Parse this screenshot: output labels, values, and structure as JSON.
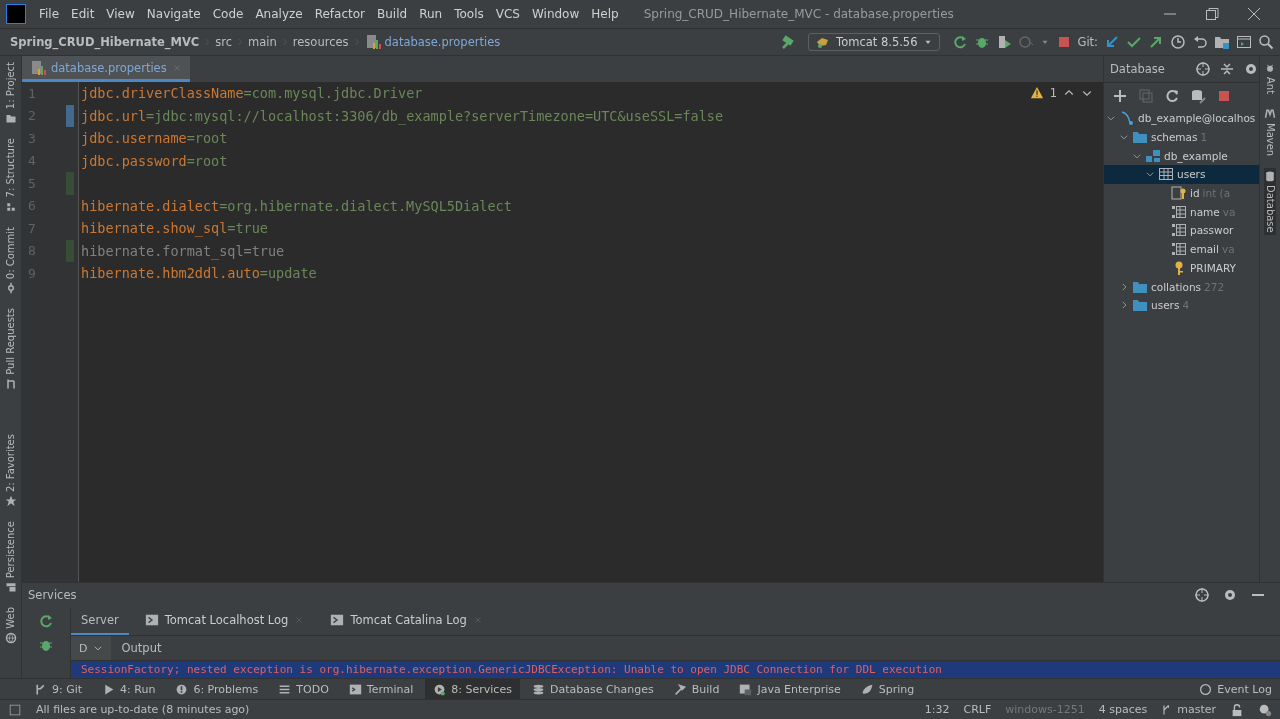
{
  "window": {
    "title": "Spring_CRUD_Hibernate_MVC - database.properties"
  },
  "menu": [
    "File",
    "Edit",
    "View",
    "Navigate",
    "Code",
    "Analyze",
    "Refactor",
    "Build",
    "Run",
    "Tools",
    "VCS",
    "Window",
    "Help"
  ],
  "breadcrumbs": [
    "Spring_CRUD_Hibernate_MVC",
    "src",
    "main",
    "resources",
    "database.properties"
  ],
  "toolbar": {
    "run_config": "Tomcat 8.5.56",
    "git_label": "Git:"
  },
  "left_stripe": [
    {
      "label": "1: Project",
      "selected": false
    },
    {
      "label": "7: Structure",
      "selected": false
    },
    {
      "label": "0: Commit",
      "selected": false
    },
    {
      "label": "Pull Requests",
      "selected": false
    },
    {
      "label": "2: Favorites",
      "selected": false
    },
    {
      "label": "Persistence",
      "selected": false
    },
    {
      "label": "Web",
      "selected": false
    }
  ],
  "right_stripe": [
    {
      "label": "Ant",
      "selected": false
    },
    {
      "label": "Maven",
      "selected": false
    },
    {
      "label": "Database",
      "selected": true
    }
  ],
  "editor": {
    "tabs": [
      {
        "label": "database.properties",
        "selected": true
      }
    ],
    "warnings": "1",
    "lines": [
      {
        "number": "1",
        "key": "jdbc.driverClassName",
        "separator": "=",
        "value": "com.mysql.jdbc.Driver",
        "dimmed": false,
        "modified": false,
        "added": false
      },
      {
        "number": "2",
        "key": "jdbc.url",
        "separator": "=",
        "value": "jdbc:mysql://localhost:3306/db_example?serverTimezone=UTC&useSSL=false",
        "dimmed": false,
        "modified": true,
        "added": false
      },
      {
        "number": "3",
        "key": "jdbc.username",
        "separator": "=",
        "value": "root",
        "dimmed": false,
        "modified": false,
        "added": false
      },
      {
        "number": "4",
        "key": "jdbc.password",
        "separator": "=",
        "value": "root",
        "dimmed": false,
        "modified": false,
        "added": false
      },
      {
        "number": "5",
        "modified": false,
        "added": true
      },
      {
        "number": "6",
        "key": "hibernate.dialect",
        "separator": "=",
        "value": "org.hibernate.dialect.MySQL5Dialect",
        "dimmed": false,
        "modified": false,
        "added": false
      },
      {
        "number": "7",
        "key": "hibernate.show_sql",
        "separator": "=",
        "value": "true",
        "dimmed": false,
        "modified": false,
        "added": false
      },
      {
        "number": "8",
        "key": "hibernate.format_sql",
        "separator": "=",
        "value": "true",
        "dimmed": true,
        "modified": false,
        "added": true
      },
      {
        "number": "9",
        "key": "hibernate.hbm2ddl.auto",
        "separator": "=",
        "value": "update",
        "dimmed": false,
        "modified": false,
        "added": false
      }
    ]
  },
  "database": {
    "title": "Database",
    "tree": [
      {
        "kind": "datasource",
        "label": "db_example@localhos",
        "expanded": true,
        "selected": false,
        "children": [
          {
            "kind": "folder",
            "label": "schemas",
            "count": "1",
            "expanded": true,
            "selected": false,
            "children": [
              {
                "kind": "schema",
                "label": "db_example",
                "expanded": true,
                "selected": false,
                "children": [
                  {
                    "kind": "table",
                    "label": "users",
                    "expanded": true,
                    "selected": true,
                    "children": [
                      {
                        "kind": "key-column",
                        "label": "id",
                        "detail": "int (a",
                        "selected": false
                      },
                      {
                        "kind": "column",
                        "label": "name",
                        "detail": "va",
                        "selected": false
                      },
                      {
                        "kind": "column",
                        "label": "passwor",
                        "selected": false
                      },
                      {
                        "kind": "column",
                        "label": "email",
                        "detail": "va",
                        "selected": false
                      },
                      {
                        "kind": "key",
                        "label": "PRIMARY",
                        "selected": false
                      }
                    ]
                  }
                ]
              }
            ]
          },
          {
            "kind": "folder",
            "label": "collations",
            "count": "272",
            "expanded": false,
            "selected": false
          },
          {
            "kind": "folder",
            "label": "users",
            "count": "4",
            "expanded": false,
            "selected": false
          }
        ]
      }
    ]
  },
  "services": {
    "title": "Services",
    "tabs": [
      {
        "label": "Server",
        "selected": true
      },
      {
        "label": "Tomcat Localhost Log",
        "selected": false
      },
      {
        "label": "Tomcat Catalina Log",
        "selected": false
      }
    ],
    "dropdown": "D",
    "output_label": "Output",
    "output_line": "SessionFactory; nested exception is org.hibernate.exception.GenericJDBCException: Unable to open JDBC Connection for DDL execution"
  },
  "tool_windows": [
    {
      "label": "9: Git",
      "selected": false
    },
    {
      "label": "4: Run",
      "selected": false
    },
    {
      "label": "6: Problems",
      "selected": false
    },
    {
      "label": "TODO",
      "selected": false
    },
    {
      "label": "Terminal",
      "selected": false
    },
    {
      "label": "8: Services",
      "selected": true
    },
    {
      "label": "Database Changes",
      "selected": false
    },
    {
      "label": "Build",
      "selected": false
    },
    {
      "label": "Java Enterprise",
      "selected": false
    },
    {
      "label": "Spring",
      "selected": false
    }
  ],
  "event_log": "Event Log",
  "status_bar": {
    "message": "All files are up-to-date (8 minutes ago)",
    "position": "1:32",
    "line_separator": "CRLF",
    "encoding": "windows-1251",
    "indent": "4 spaces",
    "branch": "master"
  }
}
